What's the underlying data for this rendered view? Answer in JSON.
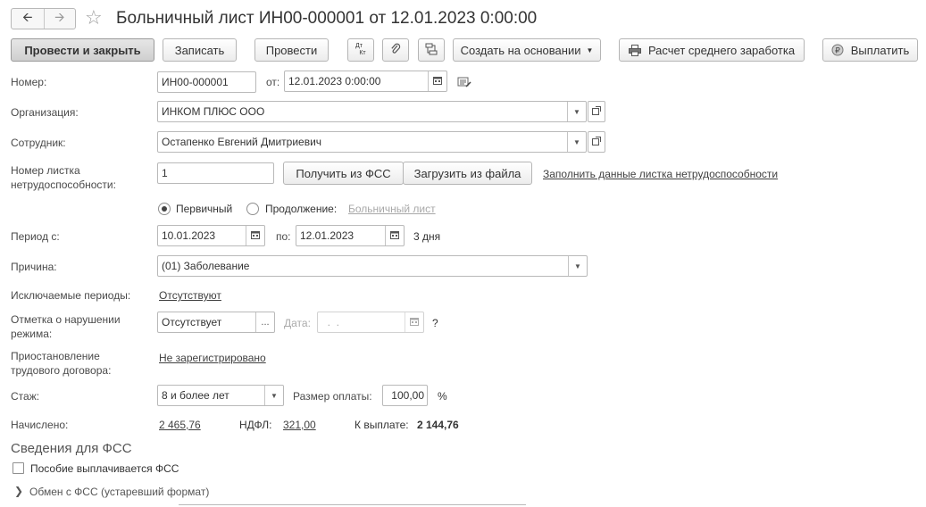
{
  "window": {
    "title": "Больничный лист ИН00-000001 от 12.01.2023 0:00:00",
    "back_icon": "arrow-left-icon",
    "forward_icon": "arrow-right-icon",
    "favorite_icon": "star-icon"
  },
  "toolbar": {
    "post_close": "Провести и закрыть",
    "save": "Записать",
    "post": "Провести",
    "dt_kt_top": "Дт",
    "dt_kt_bottom": "Кт",
    "create_based": "Создать на основании",
    "avg_earnings": "Расчет среднего заработка",
    "pay": "Выплатить"
  },
  "form": {
    "number_label": "Номер:",
    "number_value": "ИН00-000001",
    "date_from_label": "от:",
    "date_value": "12.01.2023  0:00:00",
    "org_label": "Организация:",
    "org_value": "ИНКОМ ПЛЮС ООО",
    "employee_label": "Сотрудник:",
    "employee_value": "Остапенко Евгений Дмитриевич",
    "sheet_number_label_1": "Номер листка",
    "sheet_number_label_2": "нетрудоспособности:",
    "sheet_number_value": "1",
    "get_fss": "Получить из ФСС",
    "load_file": "Загрузить из файла",
    "fill_data_link": "Заполнить данные листка нетрудоспособности",
    "primary_label": "Первичный",
    "continuation_label": "Продолжение:",
    "sick_leave_link": "Больничный лист",
    "period_label": "Период с:",
    "period_start": "10.01.2023",
    "period_to_label": "по:",
    "period_end": "12.01.2023",
    "days": "3 дня",
    "reason_label": "Причина:",
    "reason_value": "(01) Заболевание",
    "excluded_label": "Исключаемые периоды:",
    "excluded_value": "Отсутствуют",
    "violation_label_1": "Отметка о нарушении",
    "violation_label_2": "режима:",
    "violation_value": "Отсутствует",
    "violation_date_label": "Дата:",
    "violation_date_value": "  .  .",
    "question_mark": "?",
    "suspension_label_1": "Приостановление",
    "suspension_label_2": "трудового договора:",
    "suspension_value": "Не зарегистрировано",
    "experience_label": "Стаж:",
    "experience_value": "8 и более лет",
    "payment_size_label": "Размер оплаты:",
    "payment_size_value": "100,00",
    "percent": "%",
    "accrued_label": "Начислено:",
    "accrued_value": "2 465,76",
    "ndfl_label": "НДФЛ:",
    "ndfl_value": "321,00",
    "to_pay_label": "К выплате:",
    "to_pay_value": "2 144,76"
  },
  "fss": {
    "section_title": "Сведения для ФСС",
    "benefit_checkbox": "Пособие выплачивается ФСС",
    "exchange_group": "Обмен с ФСС (устаревший формат)"
  }
}
